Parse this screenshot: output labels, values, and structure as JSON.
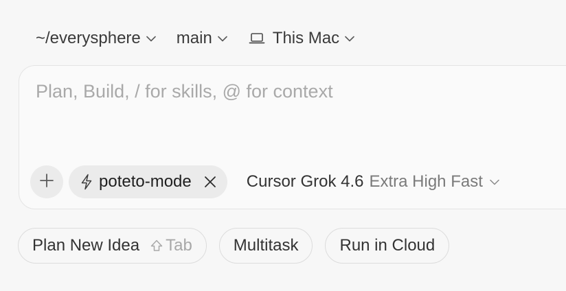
{
  "context": {
    "directory": "~/everysphere",
    "branch": "main",
    "machine": "This Mac",
    "machine_icon": "laptop-icon"
  },
  "composer": {
    "placeholder": "Plan, Build, / for skills, @ for context",
    "value": "",
    "add_icon": "plus-icon",
    "mode_chip": {
      "icon": "bolt-icon",
      "label": "poteto-mode",
      "remove_icon": "close-icon"
    },
    "model": {
      "name": "Cursor Grok 4.6",
      "variant": "Extra High Fast"
    }
  },
  "actions": [
    {
      "label": "Plan New Idea",
      "shortcut": "Tab",
      "shortcut_icon": "shift-icon"
    },
    {
      "label": "Multitask"
    },
    {
      "label": "Run in Cloud"
    }
  ],
  "colors": {
    "background": "#f7f7f7",
    "composer_bg": "#fafafa",
    "chip_bg": "#ebebeb",
    "border": "#e4e4e4",
    "muted_text": "#a9a9a9"
  }
}
